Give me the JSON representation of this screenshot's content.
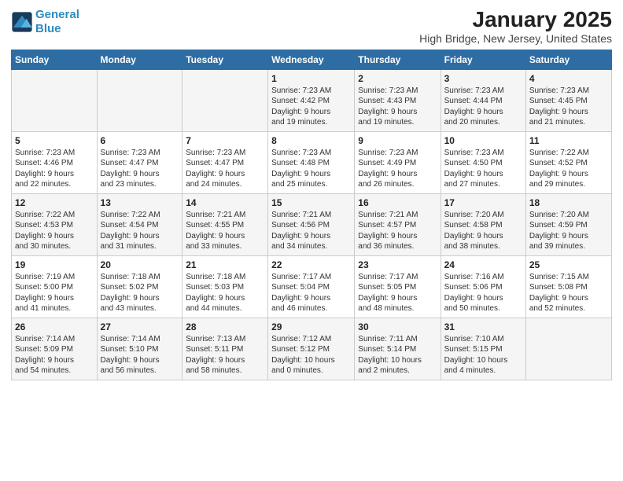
{
  "header": {
    "logo_line1": "General",
    "logo_line2": "Blue",
    "month_title": "January 2025",
    "location": "High Bridge, New Jersey, United States"
  },
  "days_of_week": [
    "Sunday",
    "Monday",
    "Tuesday",
    "Wednesday",
    "Thursday",
    "Friday",
    "Saturday"
  ],
  "weeks": [
    [
      {
        "day": "",
        "info": ""
      },
      {
        "day": "",
        "info": ""
      },
      {
        "day": "",
        "info": ""
      },
      {
        "day": "1",
        "info": "Sunrise: 7:23 AM\nSunset: 4:42 PM\nDaylight: 9 hours\nand 19 minutes."
      },
      {
        "day": "2",
        "info": "Sunrise: 7:23 AM\nSunset: 4:43 PM\nDaylight: 9 hours\nand 19 minutes."
      },
      {
        "day": "3",
        "info": "Sunrise: 7:23 AM\nSunset: 4:44 PM\nDaylight: 9 hours\nand 20 minutes."
      },
      {
        "day": "4",
        "info": "Sunrise: 7:23 AM\nSunset: 4:45 PM\nDaylight: 9 hours\nand 21 minutes."
      }
    ],
    [
      {
        "day": "5",
        "info": "Sunrise: 7:23 AM\nSunset: 4:46 PM\nDaylight: 9 hours\nand 22 minutes."
      },
      {
        "day": "6",
        "info": "Sunrise: 7:23 AM\nSunset: 4:47 PM\nDaylight: 9 hours\nand 23 minutes."
      },
      {
        "day": "7",
        "info": "Sunrise: 7:23 AM\nSunset: 4:47 PM\nDaylight: 9 hours\nand 24 minutes."
      },
      {
        "day": "8",
        "info": "Sunrise: 7:23 AM\nSunset: 4:48 PM\nDaylight: 9 hours\nand 25 minutes."
      },
      {
        "day": "9",
        "info": "Sunrise: 7:23 AM\nSunset: 4:49 PM\nDaylight: 9 hours\nand 26 minutes."
      },
      {
        "day": "10",
        "info": "Sunrise: 7:23 AM\nSunset: 4:50 PM\nDaylight: 9 hours\nand 27 minutes."
      },
      {
        "day": "11",
        "info": "Sunrise: 7:22 AM\nSunset: 4:52 PM\nDaylight: 9 hours\nand 29 minutes."
      }
    ],
    [
      {
        "day": "12",
        "info": "Sunrise: 7:22 AM\nSunset: 4:53 PM\nDaylight: 9 hours\nand 30 minutes."
      },
      {
        "day": "13",
        "info": "Sunrise: 7:22 AM\nSunset: 4:54 PM\nDaylight: 9 hours\nand 31 minutes."
      },
      {
        "day": "14",
        "info": "Sunrise: 7:21 AM\nSunset: 4:55 PM\nDaylight: 9 hours\nand 33 minutes."
      },
      {
        "day": "15",
        "info": "Sunrise: 7:21 AM\nSunset: 4:56 PM\nDaylight: 9 hours\nand 34 minutes."
      },
      {
        "day": "16",
        "info": "Sunrise: 7:21 AM\nSunset: 4:57 PM\nDaylight: 9 hours\nand 36 minutes."
      },
      {
        "day": "17",
        "info": "Sunrise: 7:20 AM\nSunset: 4:58 PM\nDaylight: 9 hours\nand 38 minutes."
      },
      {
        "day": "18",
        "info": "Sunrise: 7:20 AM\nSunset: 4:59 PM\nDaylight: 9 hours\nand 39 minutes."
      }
    ],
    [
      {
        "day": "19",
        "info": "Sunrise: 7:19 AM\nSunset: 5:00 PM\nDaylight: 9 hours\nand 41 minutes."
      },
      {
        "day": "20",
        "info": "Sunrise: 7:18 AM\nSunset: 5:02 PM\nDaylight: 9 hours\nand 43 minutes."
      },
      {
        "day": "21",
        "info": "Sunrise: 7:18 AM\nSunset: 5:03 PM\nDaylight: 9 hours\nand 44 minutes."
      },
      {
        "day": "22",
        "info": "Sunrise: 7:17 AM\nSunset: 5:04 PM\nDaylight: 9 hours\nand 46 minutes."
      },
      {
        "day": "23",
        "info": "Sunrise: 7:17 AM\nSunset: 5:05 PM\nDaylight: 9 hours\nand 48 minutes."
      },
      {
        "day": "24",
        "info": "Sunrise: 7:16 AM\nSunset: 5:06 PM\nDaylight: 9 hours\nand 50 minutes."
      },
      {
        "day": "25",
        "info": "Sunrise: 7:15 AM\nSunset: 5:08 PM\nDaylight: 9 hours\nand 52 minutes."
      }
    ],
    [
      {
        "day": "26",
        "info": "Sunrise: 7:14 AM\nSunset: 5:09 PM\nDaylight: 9 hours\nand 54 minutes."
      },
      {
        "day": "27",
        "info": "Sunrise: 7:14 AM\nSunset: 5:10 PM\nDaylight: 9 hours\nand 56 minutes."
      },
      {
        "day": "28",
        "info": "Sunrise: 7:13 AM\nSunset: 5:11 PM\nDaylight: 9 hours\nand 58 minutes."
      },
      {
        "day": "29",
        "info": "Sunrise: 7:12 AM\nSunset: 5:12 PM\nDaylight: 10 hours\nand 0 minutes."
      },
      {
        "day": "30",
        "info": "Sunrise: 7:11 AM\nSunset: 5:14 PM\nDaylight: 10 hours\nand 2 minutes."
      },
      {
        "day": "31",
        "info": "Sunrise: 7:10 AM\nSunset: 5:15 PM\nDaylight: 10 hours\nand 4 minutes."
      },
      {
        "day": "",
        "info": ""
      }
    ]
  ]
}
